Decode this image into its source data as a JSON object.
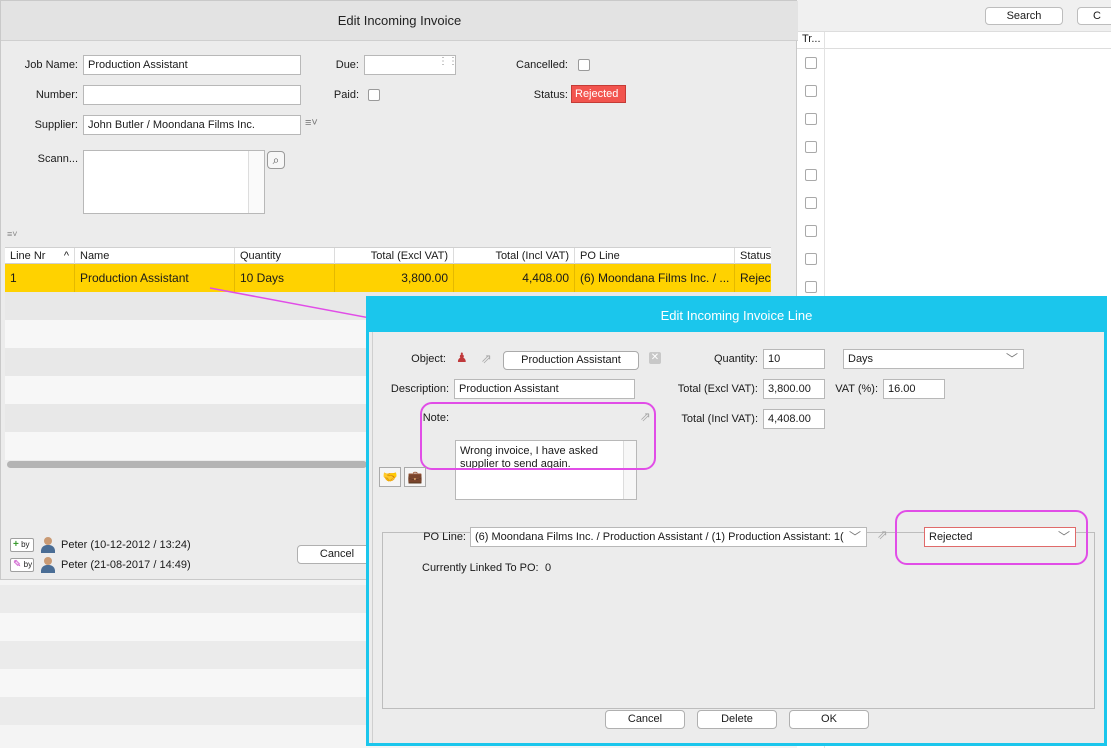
{
  "background": {
    "search_label": "Search",
    "other_button_label": "C",
    "column_header": "Tr..."
  },
  "invoice_dialog": {
    "title": "Edit Incoming Invoice",
    "job_name_label": "Job Name:",
    "job_name_value": "Production Assistant",
    "number_label": "Number:",
    "number_value": "",
    "supplier_label": "Supplier:",
    "supplier_value": "John Butler / Moondana Films Inc.",
    "scan_label": "Scann...",
    "due_label": "Due:",
    "due_value": "",
    "paid_label": "Paid:",
    "cancelled_label": "Cancelled:",
    "status_label": "Status:",
    "status_value": "Rejected",
    "status_color": "#f2544e",
    "table": {
      "columns": [
        "Line Nr",
        "Name",
        "Quantity",
        "Total (Excl VAT)",
        "Total (Incl VAT)",
        "PO Line",
        "Status"
      ],
      "rows": [
        {
          "line_nr": "1",
          "name": "Production Assistant",
          "quantity": "10 Days",
          "total_excl": "3,800.00",
          "total_incl": "4,408.00",
          "po_line": "(6) Moondana Films Inc. / ...",
          "status": "Rejec"
        }
      ],
      "selected_row_color": "#ffd200"
    },
    "audit": [
      {
        "action": "by",
        "text": "Peter (10-12-2012 / 13:24)"
      },
      {
        "action": "by",
        "text": "Peter (21-08-2017 / 14:49)"
      }
    ],
    "cancel_label": "Cancel"
  },
  "line_dialog": {
    "title": "Edit Incoming Invoice Line",
    "accent_color": "#1bc6ec",
    "object_label": "Object:",
    "object_value": "Production Assistant",
    "description_label": "Description:",
    "description_value": "Production Assistant",
    "note_label": "Note:",
    "note_value": "Wrong invoice, I have asked supplier to send again.",
    "quantity_label": "Quantity:",
    "quantity_value": "10",
    "unit_value": "Days",
    "total_excl_label": "Total (Excl VAT):",
    "total_excl_value": "3,800.00",
    "vat_label": "VAT (%):",
    "vat_value": "16.00",
    "total_incl_label": "Total (Incl VAT):",
    "total_incl_value": "4,408.00",
    "po_line_label": "PO Line:",
    "po_line_value": "(6) Moondana Films Inc. / Production Assistant / (1) Production Assistant: 1(",
    "po_status_value": "Rejected",
    "linked_label": "Currently Linked To PO:",
    "linked_value": "0",
    "cancel_label": "Cancel",
    "delete_label": "Delete",
    "ok_label": "OK",
    "highlight_color": "#e14de7"
  }
}
